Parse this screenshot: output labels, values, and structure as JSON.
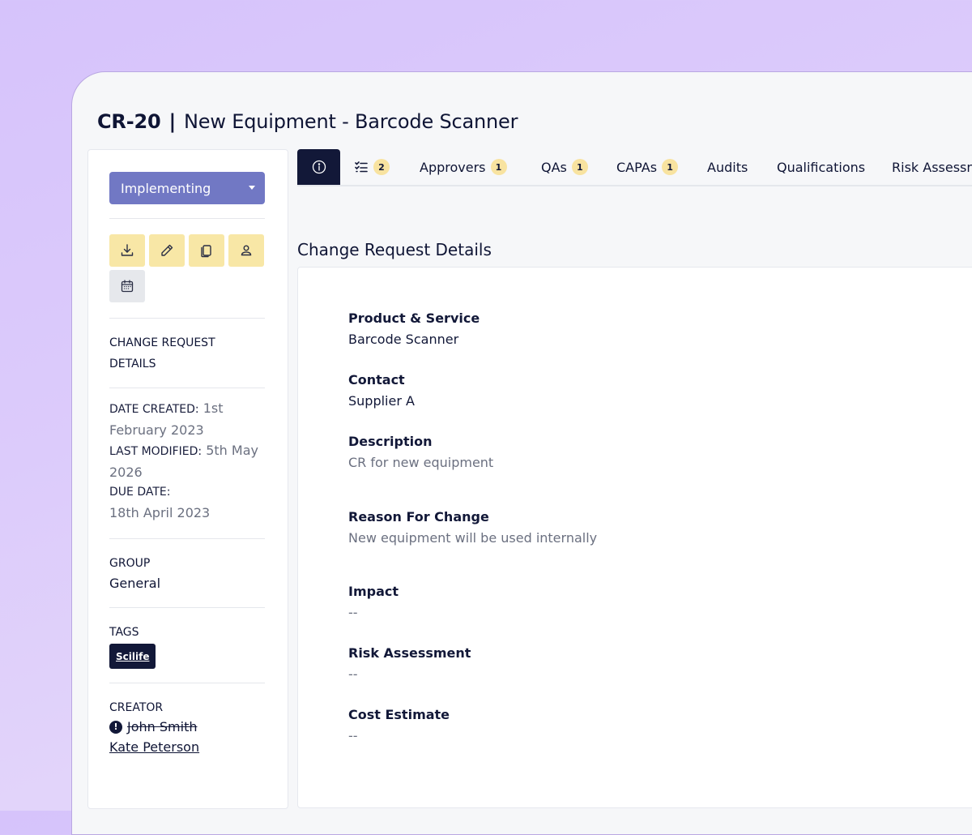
{
  "header": {
    "code": "CR-20",
    "separator": "|",
    "title": "New Equipment - Barcode Scanner"
  },
  "sidebar": {
    "status": "Implementing",
    "actions": [
      {
        "name": "download-icon"
      },
      {
        "name": "pencil-icon"
      },
      {
        "name": "copy-icon"
      },
      {
        "name": "user-icon"
      },
      {
        "name": "calendar-icon"
      }
    ],
    "section_heading": "Change Request Details",
    "date_created_label": "DATE CREATED:",
    "date_created_value": "1st February 2023",
    "last_modified_label": "LAST MODIFIED:",
    "last_modified_value": "5th May 2026",
    "due_date_label": "DUE DATE:",
    "due_date_value": "18th April 2023",
    "group_label": "GROUP",
    "group_value": "General",
    "tags_label": "TAGS",
    "tags": [
      "Scilife"
    ],
    "creator_label": "CREATOR",
    "creator_previous": "John Smith",
    "creator_current": "Kate Peterson"
  },
  "tabs": [
    {
      "label": "",
      "icon": "info-icon",
      "active": true
    },
    {
      "label": "",
      "icon": "checklist-icon",
      "count": "2"
    },
    {
      "label": "Approvers",
      "count": "1"
    },
    {
      "label": "QAs",
      "count": "1"
    },
    {
      "label": "CAPAs",
      "count": "1"
    },
    {
      "label": "Audits"
    },
    {
      "label": "Qualifications"
    },
    {
      "label": "Risk Assessn"
    }
  ],
  "main": {
    "section_title": "Change Request Details",
    "fields": [
      {
        "label": "Product & Service",
        "value": "Barcode Scanner"
      },
      {
        "label": "Contact",
        "value": "Supplier A"
      },
      {
        "label": "Description",
        "value": "CR for new equipment"
      },
      {
        "label": "Reason For Change",
        "value": "New equipment will be used internally"
      },
      {
        "label": "Impact",
        "value": "--"
      },
      {
        "label": "Risk Assessment",
        "value": "--"
      },
      {
        "label": "Cost Estimate",
        "value": "--"
      }
    ]
  },
  "colors": {
    "status_fill": "#7178c4",
    "action_fill": "#f8e7a6",
    "navy": "#121838",
    "badge": "#f8e3a0"
  }
}
